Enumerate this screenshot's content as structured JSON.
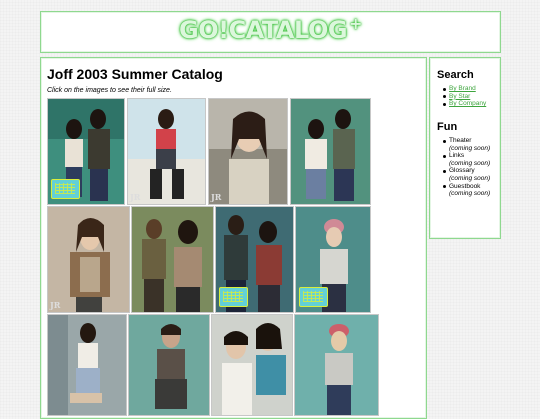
{
  "site": {
    "logo_text": "GO!CATALOG",
    "logo_plus": "+"
  },
  "main": {
    "title": "Joff 2003 Summer Catalog",
    "hint": "Click on the images to see their full size."
  },
  "sidebar": {
    "search_heading": "Search",
    "search_links": [
      "By Brand",
      "By Star",
      "By Company"
    ],
    "fun_heading": "Fun",
    "fun_items": [
      {
        "label": "Theater",
        "note": "(coming soon)"
      },
      {
        "label": "Links",
        "note": "(coming soon)"
      },
      {
        "label": "Glossary",
        "note": "(coming soon)"
      },
      {
        "label": "Guestbook",
        "note": "(coming soon)"
      }
    ]
  },
  "colors": {
    "accent": "#3ea53e",
    "border": "#8fd88f",
    "badge": "#63d0d6"
  }
}
